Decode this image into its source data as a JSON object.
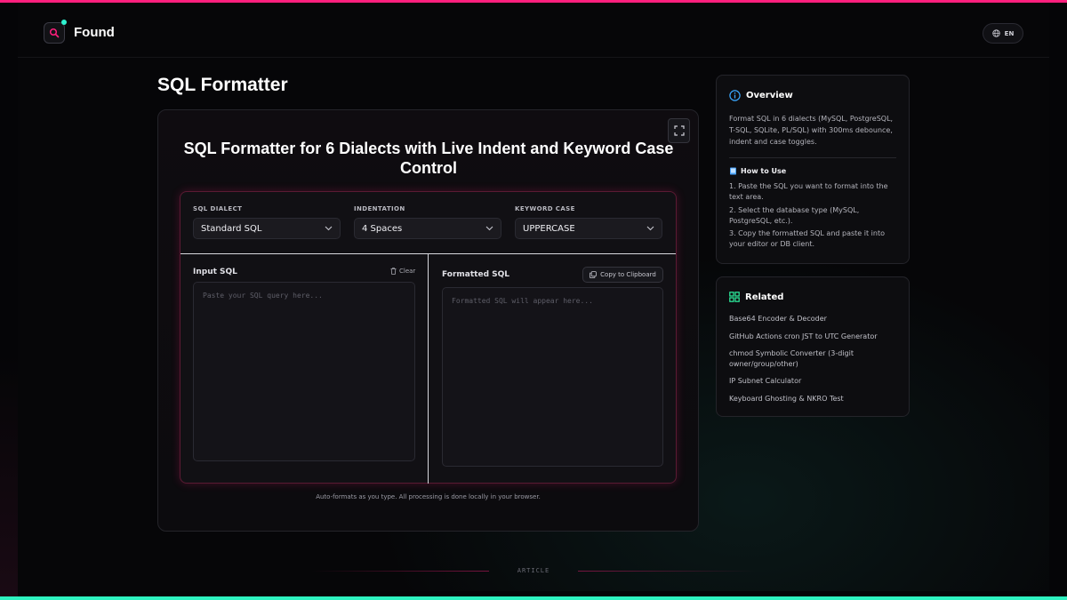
{
  "header": {
    "brand": "Found",
    "lang": "EN"
  },
  "page": {
    "title": "SQL Formatter"
  },
  "tool": {
    "title": "SQL Formatter for 6 Dialects with Live Indent and Keyword Case Control",
    "options": [
      {
        "label": "SQL DIALECT",
        "value": "Standard SQL"
      },
      {
        "label": "INDENTATION",
        "value": "4 Spaces"
      },
      {
        "label": "KEYWORD CASE",
        "value": "UPPERCASE"
      }
    ],
    "input": {
      "label": "Input SQL",
      "clear_label": "Clear",
      "placeholder": "Paste your SQL query here..."
    },
    "output": {
      "label": "Formatted SQL",
      "copy_label": "Copy to Clipboard",
      "placeholder": "Formatted SQL will appear here..."
    },
    "footnote": "Auto-formats as you type. All processing is done locally in your browser."
  },
  "overview": {
    "title": "Overview",
    "text": "Format SQL in 6 dialects (MySQL, PostgreSQL, T-SQL, SQLite, PL/SQL) with 300ms debounce, indent and case toggles.",
    "howto_title": "How to Use",
    "steps": [
      "1. Paste the SQL you want to format into the text area.",
      "2. Select the database type (MySQL, PostgreSQL, etc.).",
      "3. Copy the formatted SQL and paste it into your editor or DB client."
    ]
  },
  "related": {
    "title": "Related",
    "links": [
      "Base64 Encoder & Decoder",
      "GitHub Actions cron JST to UTC Generator",
      "chmod Symbolic Converter (3-digit owner/group/other)",
      "IP Subnet Calculator",
      "Keyboard Ghosting & NKRO Test"
    ]
  },
  "footer": {
    "section_label": "ARTICLE"
  },
  "colors": {
    "accent_pink": "#ff1f7d",
    "accent_teal": "#2ef2c0",
    "background": "#050507"
  },
  "icons": [
    "search-icon",
    "globe-icon",
    "fullscreen-icon",
    "chevron-down-icon",
    "trash-icon",
    "copy-icon",
    "info-icon",
    "book-icon",
    "grid-icon"
  ]
}
